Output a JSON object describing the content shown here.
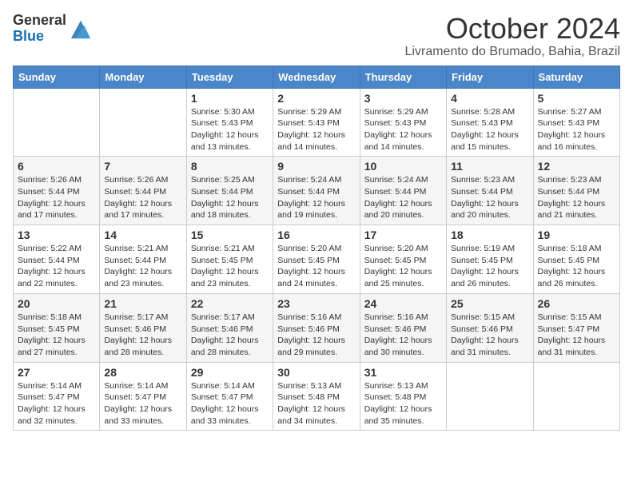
{
  "header": {
    "logo_general": "General",
    "logo_blue": "Blue",
    "month_title": "October 2024",
    "subtitle": "Livramento do Brumado, Bahia, Brazil"
  },
  "calendar": {
    "days_of_week": [
      "Sunday",
      "Monday",
      "Tuesday",
      "Wednesday",
      "Thursday",
      "Friday",
      "Saturday"
    ],
    "weeks": [
      [
        {
          "day": "",
          "info": ""
        },
        {
          "day": "",
          "info": ""
        },
        {
          "day": "1",
          "info": "Sunrise: 5:30 AM\nSunset: 5:43 PM\nDaylight: 12 hours\nand 13 minutes."
        },
        {
          "day": "2",
          "info": "Sunrise: 5:29 AM\nSunset: 5:43 PM\nDaylight: 12 hours\nand 14 minutes."
        },
        {
          "day": "3",
          "info": "Sunrise: 5:29 AM\nSunset: 5:43 PM\nDaylight: 12 hours\nand 14 minutes."
        },
        {
          "day": "4",
          "info": "Sunrise: 5:28 AM\nSunset: 5:43 PM\nDaylight: 12 hours\nand 15 minutes."
        },
        {
          "day": "5",
          "info": "Sunrise: 5:27 AM\nSunset: 5:43 PM\nDaylight: 12 hours\nand 16 minutes."
        }
      ],
      [
        {
          "day": "6",
          "info": "Sunrise: 5:26 AM\nSunset: 5:44 PM\nDaylight: 12 hours\nand 17 minutes."
        },
        {
          "day": "7",
          "info": "Sunrise: 5:26 AM\nSunset: 5:44 PM\nDaylight: 12 hours\nand 17 minutes."
        },
        {
          "day": "8",
          "info": "Sunrise: 5:25 AM\nSunset: 5:44 PM\nDaylight: 12 hours\nand 18 minutes."
        },
        {
          "day": "9",
          "info": "Sunrise: 5:24 AM\nSunset: 5:44 PM\nDaylight: 12 hours\nand 19 minutes."
        },
        {
          "day": "10",
          "info": "Sunrise: 5:24 AM\nSunset: 5:44 PM\nDaylight: 12 hours\nand 20 minutes."
        },
        {
          "day": "11",
          "info": "Sunrise: 5:23 AM\nSunset: 5:44 PM\nDaylight: 12 hours\nand 20 minutes."
        },
        {
          "day": "12",
          "info": "Sunrise: 5:23 AM\nSunset: 5:44 PM\nDaylight: 12 hours\nand 21 minutes."
        }
      ],
      [
        {
          "day": "13",
          "info": "Sunrise: 5:22 AM\nSunset: 5:44 PM\nDaylight: 12 hours\nand 22 minutes."
        },
        {
          "day": "14",
          "info": "Sunrise: 5:21 AM\nSunset: 5:44 PM\nDaylight: 12 hours\nand 23 minutes."
        },
        {
          "day": "15",
          "info": "Sunrise: 5:21 AM\nSunset: 5:45 PM\nDaylight: 12 hours\nand 23 minutes."
        },
        {
          "day": "16",
          "info": "Sunrise: 5:20 AM\nSunset: 5:45 PM\nDaylight: 12 hours\nand 24 minutes."
        },
        {
          "day": "17",
          "info": "Sunrise: 5:20 AM\nSunset: 5:45 PM\nDaylight: 12 hours\nand 25 minutes."
        },
        {
          "day": "18",
          "info": "Sunrise: 5:19 AM\nSunset: 5:45 PM\nDaylight: 12 hours\nand 26 minutes."
        },
        {
          "day": "19",
          "info": "Sunrise: 5:18 AM\nSunset: 5:45 PM\nDaylight: 12 hours\nand 26 minutes."
        }
      ],
      [
        {
          "day": "20",
          "info": "Sunrise: 5:18 AM\nSunset: 5:45 PM\nDaylight: 12 hours\nand 27 minutes."
        },
        {
          "day": "21",
          "info": "Sunrise: 5:17 AM\nSunset: 5:46 PM\nDaylight: 12 hours\nand 28 minutes."
        },
        {
          "day": "22",
          "info": "Sunrise: 5:17 AM\nSunset: 5:46 PM\nDaylight: 12 hours\nand 28 minutes."
        },
        {
          "day": "23",
          "info": "Sunrise: 5:16 AM\nSunset: 5:46 PM\nDaylight: 12 hours\nand 29 minutes."
        },
        {
          "day": "24",
          "info": "Sunrise: 5:16 AM\nSunset: 5:46 PM\nDaylight: 12 hours\nand 30 minutes."
        },
        {
          "day": "25",
          "info": "Sunrise: 5:15 AM\nSunset: 5:46 PM\nDaylight: 12 hours\nand 31 minutes."
        },
        {
          "day": "26",
          "info": "Sunrise: 5:15 AM\nSunset: 5:47 PM\nDaylight: 12 hours\nand 31 minutes."
        }
      ],
      [
        {
          "day": "27",
          "info": "Sunrise: 5:14 AM\nSunset: 5:47 PM\nDaylight: 12 hours\nand 32 minutes."
        },
        {
          "day": "28",
          "info": "Sunrise: 5:14 AM\nSunset: 5:47 PM\nDaylight: 12 hours\nand 33 minutes."
        },
        {
          "day": "29",
          "info": "Sunrise: 5:14 AM\nSunset: 5:47 PM\nDaylight: 12 hours\nand 33 minutes."
        },
        {
          "day": "30",
          "info": "Sunrise: 5:13 AM\nSunset: 5:48 PM\nDaylight: 12 hours\nand 34 minutes."
        },
        {
          "day": "31",
          "info": "Sunrise: 5:13 AM\nSunset: 5:48 PM\nDaylight: 12 hours\nand 35 minutes."
        },
        {
          "day": "",
          "info": ""
        },
        {
          "day": "",
          "info": ""
        }
      ]
    ]
  }
}
